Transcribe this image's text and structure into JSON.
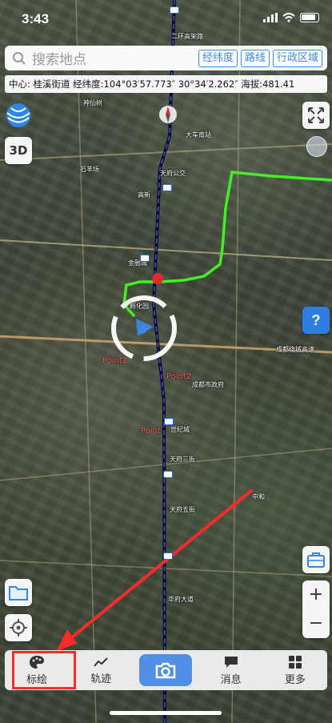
{
  "status_bar": {
    "time": "3:43"
  },
  "search": {
    "placeholder": "搜索地点",
    "chips": [
      "经纬度",
      "路线",
      "行政区域"
    ]
  },
  "info_strip": {
    "text": "中心: 桂溪街道 经纬度:104°03′57.773″ 30°34′2.262″ 海拔:481.41"
  },
  "left_controls": {
    "three_d_label": "3D"
  },
  "map": {
    "labels": [
      {
        "text": "二环高架路",
        "pos": "l1"
      },
      {
        "text": "大车南站",
        "pos": "l2"
      },
      {
        "text": "天府公交",
        "pos": "l3"
      },
      {
        "text": "高新",
        "pos": "l4"
      },
      {
        "text": "金融城",
        "pos": "l5"
      },
      {
        "text": "孵化园",
        "pos": "l6"
      },
      {
        "text": "成都市政府",
        "pos": "l7"
      },
      {
        "text": "世纪城",
        "pos": "l8"
      },
      {
        "text": "天府三街",
        "pos": "l9"
      },
      {
        "text": "天府五街",
        "pos": "l10"
      },
      {
        "text": "华府大道",
        "pos": "l11"
      },
      {
        "text": "石羊场",
        "pos": "l12"
      },
      {
        "text": "成都绕城高速",
        "pos": "l13"
      },
      {
        "text": "中和",
        "pos": "l14"
      },
      {
        "text": "神仙树",
        "pos": "l15"
      }
    ],
    "points": [
      {
        "text": "Point1"
      },
      {
        "text": "Point2"
      },
      {
        "text": "Point"
      }
    ]
  },
  "bottom_bar": {
    "tabs": [
      {
        "label": "标绘",
        "icon": "palette-icon"
      },
      {
        "label": "轨迹",
        "icon": "chart-line-icon"
      },
      {
        "label": "",
        "icon": "camera-icon"
      },
      {
        "label": "消息",
        "icon": "chat-bubble-icon"
      },
      {
        "label": "更多",
        "icon": "grid-icon"
      }
    ]
  },
  "colors": {
    "accent": "#4f8fe6",
    "chip_border": "#3c87e0",
    "annotation": "#ff2a2a",
    "track": "#44ee22"
  }
}
